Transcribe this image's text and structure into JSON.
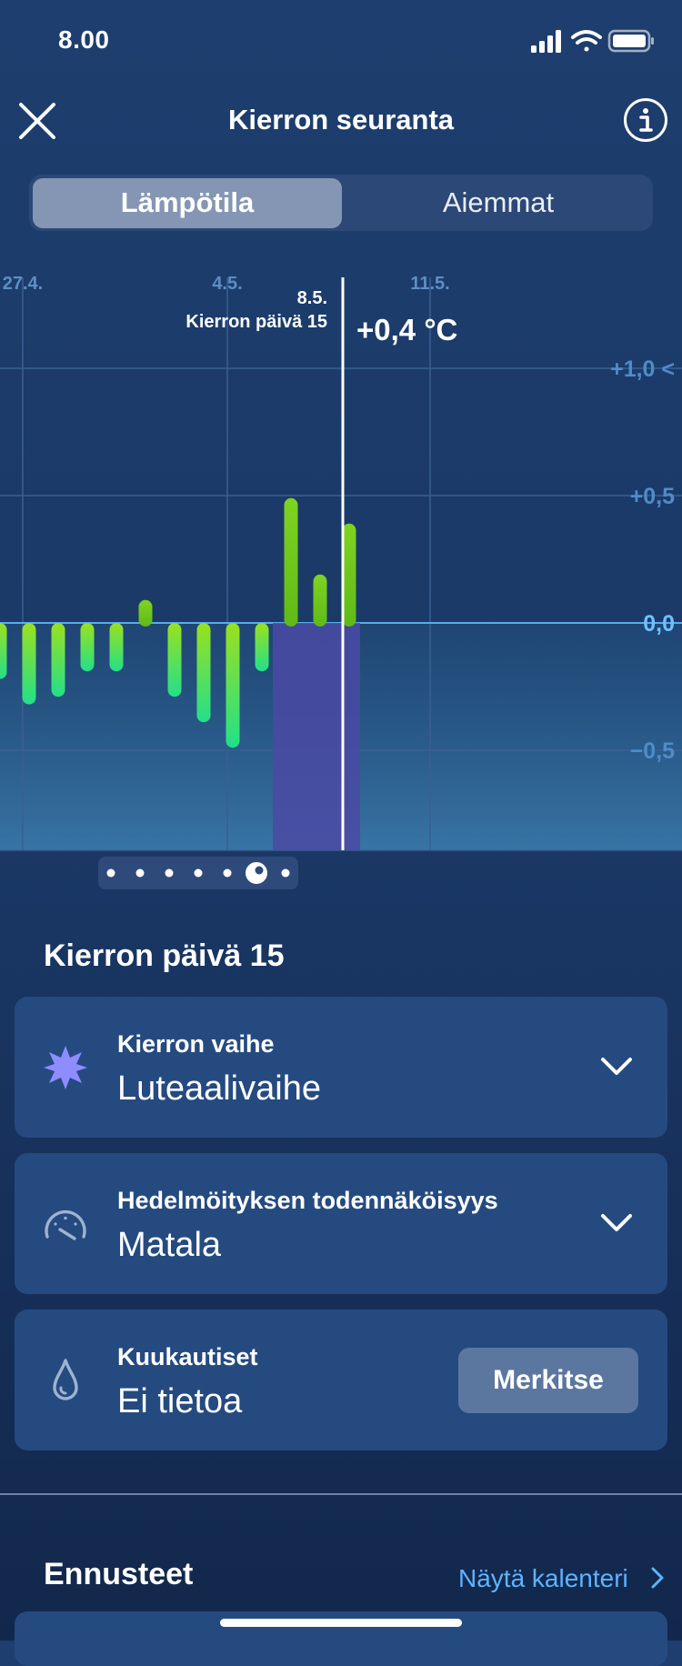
{
  "status_bar": {
    "time": "8.00"
  },
  "header": {
    "title": "Kierron seuranta"
  },
  "segmented": {
    "active_label": "Lämpötila",
    "inactive_label": "Aiemmat"
  },
  "chart_data": {
    "type": "bar",
    "x_ticks": [
      "27.4.",
      "4.5.",
      "11.5."
    ],
    "y_ticks": [
      "+1,0 <",
      "+0,5",
      "0,0",
      "−0,5"
    ],
    "values": [
      -0.22,
      -0.32,
      -0.29,
      -0.19,
      -0.19,
      0.09,
      -0.29,
      -0.39,
      -0.49,
      -0.19,
      0.49,
      0.19,
      0.39
    ],
    "selected": {
      "date": "8.5.",
      "cycle_day": "Kierron päivä 15",
      "value": "+0,4 °C"
    },
    "colors": {
      "rising": "#7fd321",
      "falling": "#33e37f",
      "shading": "#4a4aa3",
      "zero_line": "#56aee6"
    }
  },
  "page_dots": {
    "count": 7,
    "active_index": 5
  },
  "cycle_day": {
    "title": "Kierron päivä 15",
    "cards": [
      {
        "label": "Kierron vaihe",
        "value": "Luteaalivaihe",
        "icon": "sparkle-icon"
      },
      {
        "label": "Hedelmöityksen todennäköisyys",
        "value": "Matala",
        "icon": "gauge-icon"
      },
      {
        "label": "Kuukautiset",
        "value": "Ei tietoa",
        "icon": "drop-icon",
        "button": "Merkitse"
      }
    ]
  },
  "forecast": {
    "title": "Ennusteet",
    "link": "Näytä kalenteri"
  }
}
